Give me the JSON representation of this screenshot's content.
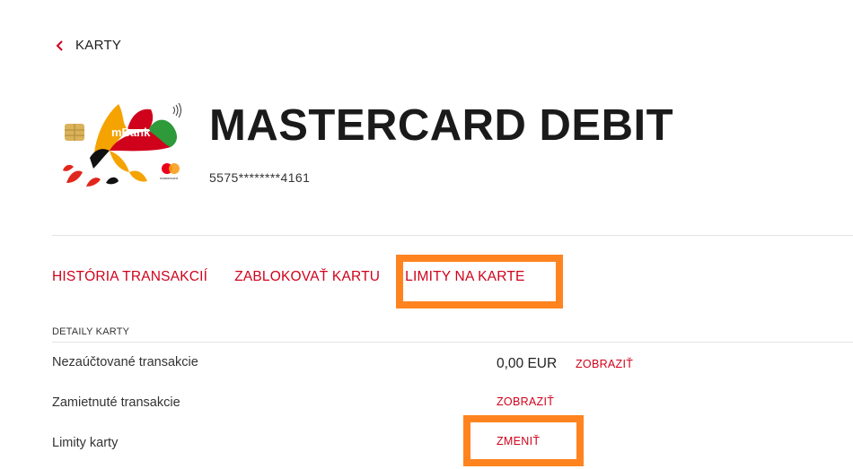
{
  "back": {
    "label": "KARTY"
  },
  "card": {
    "brand": "mBank",
    "network": "mastercard",
    "title": "MASTERCARD DEBIT",
    "number": "5575********4161"
  },
  "tabs": [
    {
      "label": "HISTÓRIA TRANSAKCIÍ"
    },
    {
      "label": "ZABLOKOVAŤ KARTU"
    },
    {
      "label": "LIMITY NA KARTE"
    }
  ],
  "details": {
    "section_title": "DETAILY KARTY",
    "rows": [
      {
        "label": "Nezaúčtované transakcie",
        "amount": "0,00 EUR",
        "action": "ZOBRAZIŤ"
      },
      {
        "label": "Zamietnuté transakcie",
        "action": "ZOBRAZIŤ"
      },
      {
        "label": "Limity karty",
        "action": "ZMENIŤ"
      }
    ]
  },
  "colors": {
    "accent": "#d0021b",
    "highlight": "#ff8420"
  }
}
